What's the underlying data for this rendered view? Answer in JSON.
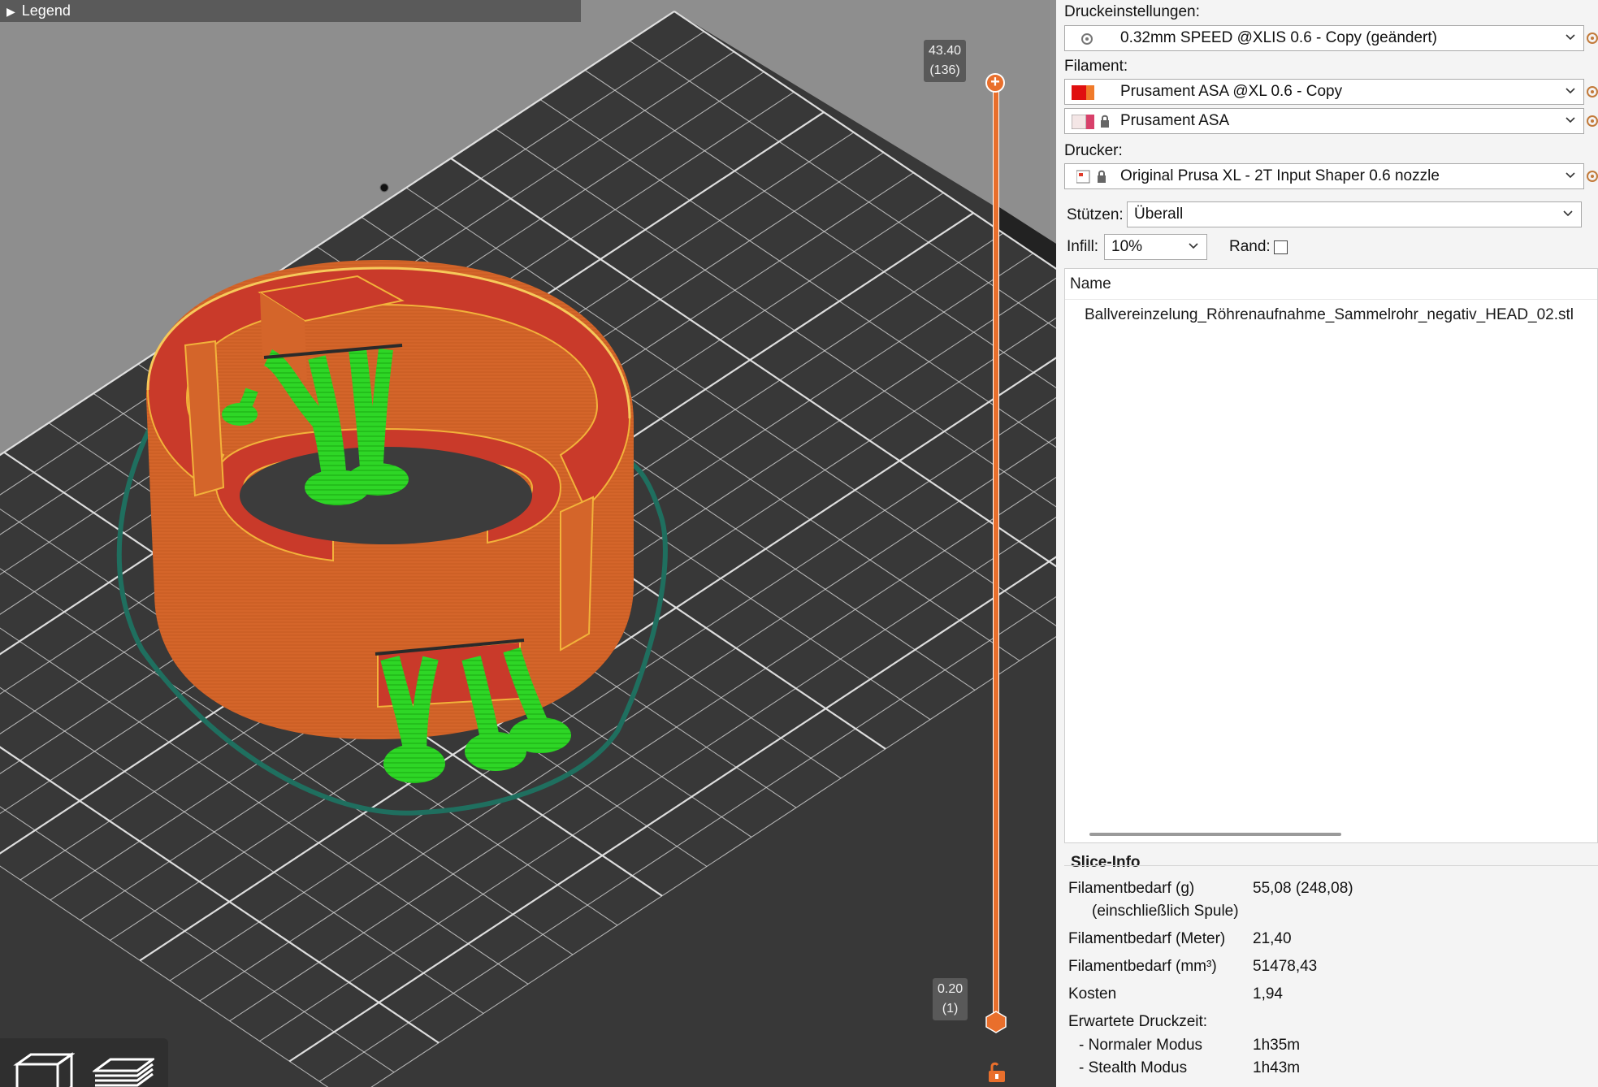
{
  "viewport": {
    "legend_label": "Legend",
    "layer_top": {
      "height": "43.40",
      "layer": "(136)"
    },
    "layer_bottom": {
      "height": "0.20",
      "layer": "(1)"
    },
    "colors": {
      "background": "#8e8e8e",
      "bed": "#383838",
      "grid": "#e6e6e6",
      "wall": "#d4652a",
      "top_surface": "#c93a2a",
      "support": "#22e01b",
      "skirt": "#1f6f5f",
      "slider": "#e96f2c"
    },
    "toolbar_icons": [
      "cube-view-icon",
      "layers-view-icon"
    ]
  },
  "sidebar": {
    "print_settings": {
      "label": "Druckeinstellungen:",
      "value": "0.32mm SPEED @XLIS 0.6 - Copy (geändert)"
    },
    "filament": {
      "label": "Filament:",
      "items": [
        {
          "value": "Prusament ASA @XL 0.6 - Copy",
          "color_a": "#e01010",
          "color_b": "#f07a2a"
        },
        {
          "value": "Prusament ASA",
          "color_a": "#f4e6e6",
          "color_b": "#d8406a"
        }
      ]
    },
    "printer": {
      "label": "Drucker:",
      "value": "Original Prusa XL - 2T Input Shaper 0.6 nozzle"
    },
    "supports": {
      "label": "Stützen:",
      "value": "Überall"
    },
    "infill": {
      "label": "Infill:",
      "value": "10%"
    },
    "brim": {
      "label": "Rand:",
      "checked": false
    },
    "object_list": {
      "header": "Name",
      "items": [
        "Ballvereinzelung_Röhrenaufnahme_Sammelrohr_negativ_HEAD_02.stl"
      ]
    },
    "slice_info": {
      "title": "Slice-Info",
      "rows": [
        {
          "label": "Filamentbedarf (g)",
          "value": "55,08 (248,08)"
        },
        {
          "label": "(einschließlich Spule)",
          "value": ""
        },
        {
          "label": "Filamentbedarf (Meter)",
          "value": "21,40"
        },
        {
          "label": "Filamentbedarf (mm³)",
          "value": "51478,43"
        },
        {
          "label": "Kosten",
          "value": "1,94"
        },
        {
          "label": "Erwartete Druckzeit:",
          "value": ""
        },
        {
          "label": "- Normaler Modus",
          "value": "1h35m"
        },
        {
          "label": "- Stealth Modus",
          "value": "1h43m"
        }
      ]
    }
  }
}
